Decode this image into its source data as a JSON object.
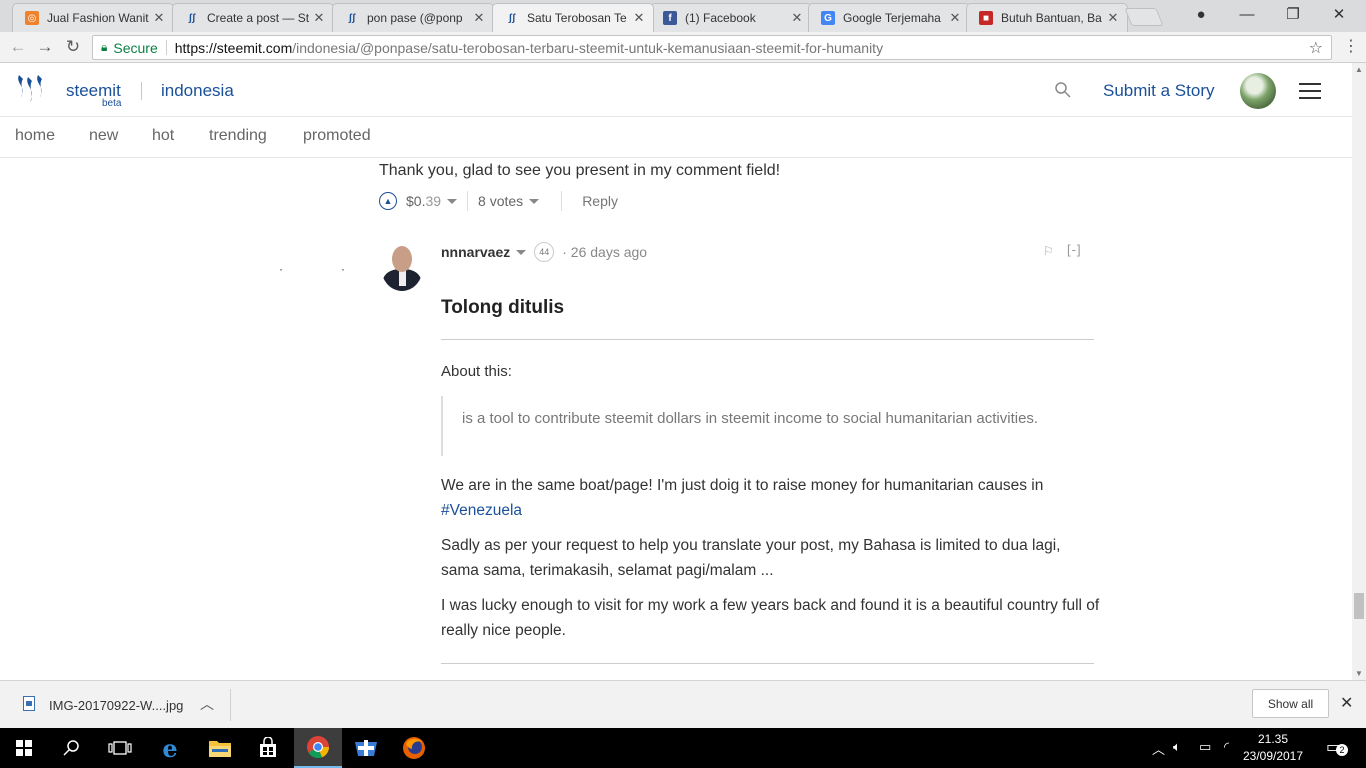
{
  "browser": {
    "tabs": [
      {
        "title": "Jual Fashion Wanit",
        "favicon": "shop-icon",
        "active": false
      },
      {
        "title": "Create a post — St",
        "favicon": "steemit-icon",
        "active": false
      },
      {
        "title": "pon pase (@ponp",
        "favicon": "steemit-icon",
        "active": false
      },
      {
        "title": "Satu Terobosan Te",
        "favicon": "steemit-icon",
        "active": true
      },
      {
        "title": "(1) Facebook",
        "favicon": "facebook-icon",
        "active": false
      },
      {
        "title": "Google Terjemaha",
        "favicon": "google-translate-icon",
        "active": false
      },
      {
        "title": "Butuh Bantuan, Ba",
        "favicon": "news-icon",
        "active": false
      }
    ],
    "secure_label": "Secure",
    "url_scheme_host": "https://steemit.com",
    "url_path": "/indonesia/@ponpase/satu-terobosan-terbaru-steemit-untuk-kemanusiaan-steemit-for-humanity"
  },
  "header": {
    "brand": "steemit",
    "beta": "beta",
    "community": "indonesia",
    "submit_label": "Submit a Story"
  },
  "subnav": {
    "items": [
      "home",
      "new",
      "hot",
      "trending",
      "promoted"
    ]
  },
  "reply_comment": {
    "text": "Thank you, glad to see you present in my comment field!",
    "payout_dollars": "$0.",
    "payout_cents": "39",
    "votes": "8 votes",
    "reply_label": "Reply"
  },
  "comment": {
    "author": "nnnarvaez",
    "reputation": "44",
    "age": "· 26 days ago",
    "collapse_label": "[-]",
    "title": "Tolong ditulis",
    "about": "About this:",
    "quote": "is a tool to contribute steemit dollars in steemit income to social humanitarian activities.",
    "para1_text": "We are in the same boat/page! I'm just doig it to raise money for humanitarian causes in",
    "para1_link": "#Venezuela",
    "para2": "Sadly as per your request to help you translate your post, my Bahasa is limited to dua lagi, sama sama, terimakasih, selamat pagi/malam ...",
    "para3": "I was lucky enough to visit for my work a few years back and found it is a beautiful country full of really nice people."
  },
  "downloads": {
    "filename": "IMG-20170922-W....jpg",
    "show_all": "Show all"
  },
  "taskbar": {
    "time": "21.35",
    "date": "23/09/2017",
    "notifications": "2"
  },
  "colors": {
    "steemit_blue": "#1a5099",
    "secure_green": "#0b8043"
  }
}
